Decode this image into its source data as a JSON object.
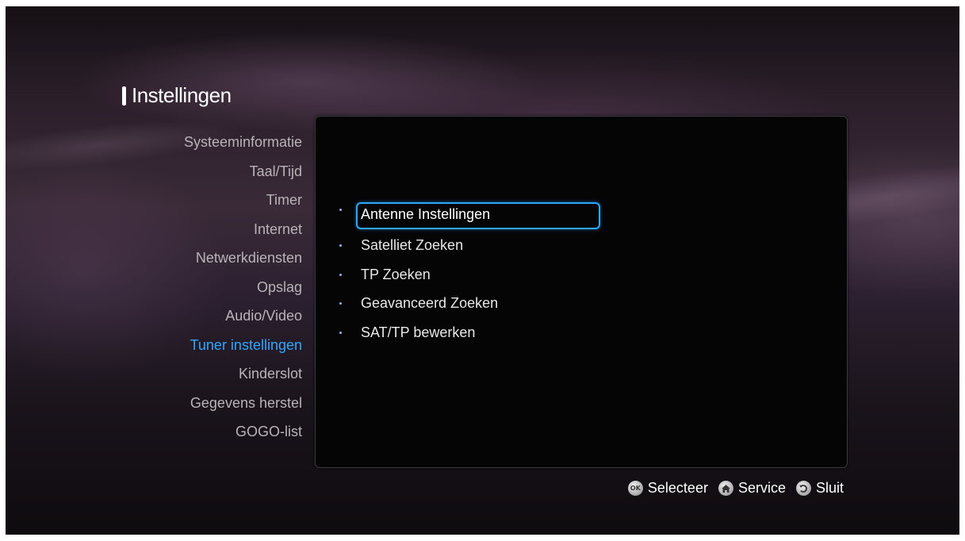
{
  "page": {
    "title": "Instellingen"
  },
  "sidebar": {
    "items": [
      {
        "label": "Systeeminformatie"
      },
      {
        "label": "Taal/Tijd"
      },
      {
        "label": "Timer"
      },
      {
        "label": "Internet"
      },
      {
        "label": "Netwerkdiensten"
      },
      {
        "label": "Opslag"
      },
      {
        "label": "Audio/Video"
      },
      {
        "label": "Tuner instellingen",
        "selected": true
      },
      {
        "label": "Kinderslot"
      },
      {
        "label": "Gegevens herstel"
      },
      {
        "label": "GOGO-list"
      }
    ]
  },
  "submenu": {
    "items": [
      {
        "label": "Antenne Instellingen",
        "focused": true
      },
      {
        "label": "Satelliet Zoeken"
      },
      {
        "label": "TP Zoeken"
      },
      {
        "label": "Geavanceerd Zoeken"
      },
      {
        "label": "SAT/TP bewerken"
      }
    ]
  },
  "footer": {
    "select": {
      "icon": "ok-button-icon",
      "label": "Selecteer"
    },
    "service": {
      "icon": "home-button-icon",
      "label": "Service"
    },
    "close": {
      "icon": "back-button-icon",
      "label": "Sluit"
    }
  },
  "colors": {
    "accent": "#2fa7ff",
    "sidebar_text": "#b8b4b8",
    "panel_bg": "#050506"
  }
}
